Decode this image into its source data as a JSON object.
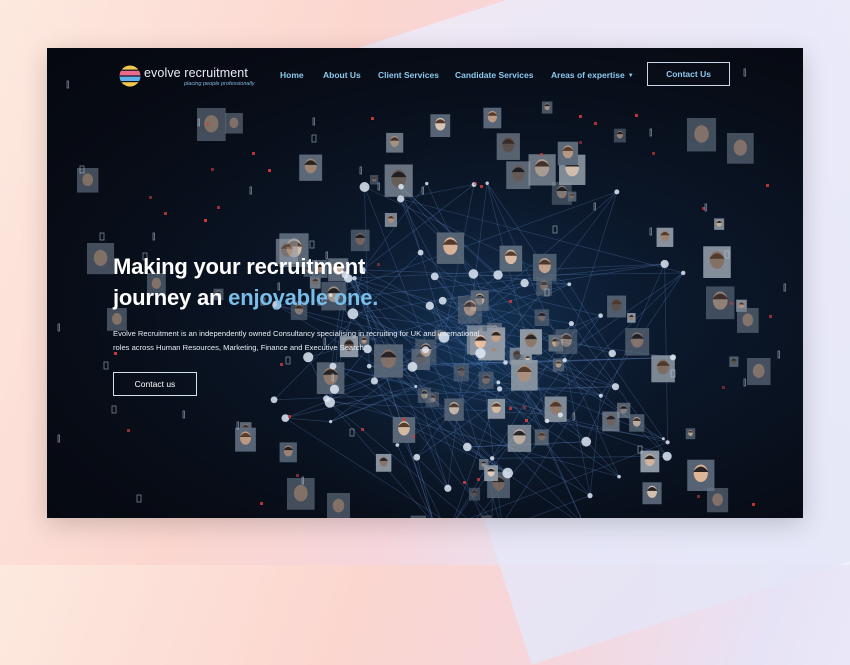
{
  "brand": {
    "name": "evolve recruitment",
    "tagline": "placing people professionally",
    "logo_icon": "evolve-stripes-logo",
    "colors": [
      "#f2c94c",
      "#ec6a8c",
      "#5fb0e8",
      "#9b7fe0"
    ]
  },
  "nav": {
    "items": [
      {
        "label": "Home"
      },
      {
        "label": "About Us"
      },
      {
        "label": "Client Services"
      },
      {
        "label": "Candidate Services"
      },
      {
        "label": "Areas of expertise",
        "icon": "chevron-down-icon"
      }
    ],
    "cta_label": "Contact Us"
  },
  "hero": {
    "title_line1": "Making your recruitment",
    "title_line2_prefix": "journey an ",
    "title_line2_accent": "enjoyable one.",
    "description": "Evolve Recruitment is an independently owned Consultancy specialising in recruiting for UK and international roles across Human Resources, Marketing, Finance and Executive Search.",
    "cta_label": "Contact us"
  },
  "colors": {
    "accent": "#79bde8",
    "nav_link": "#8ec8ee",
    "background": "#070b14"
  }
}
